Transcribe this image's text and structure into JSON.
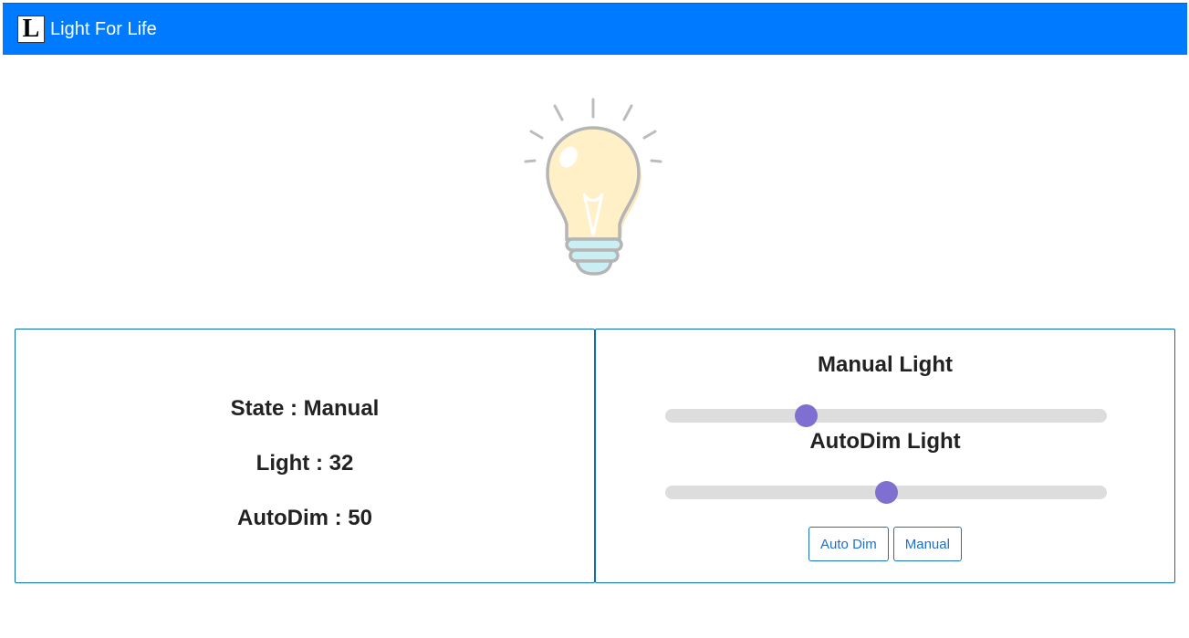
{
  "navbar": {
    "logo_letter": "L",
    "brand": "Light For Life",
    "color": "#007bff"
  },
  "status": {
    "state": "State : Manual",
    "light": "Light : 32",
    "autodim": "AutoDim : 50"
  },
  "controls": {
    "manual_title": "Manual Light",
    "manual_value": 32,
    "autodim_title": "AutoDim Light",
    "autodim_value": 50,
    "slider_max": 100,
    "thumb_color": "#7f6fd0",
    "auto_dim_button": "Auto Dim",
    "manual_button": "Manual"
  },
  "bulb": {
    "icon": "light-bulb-icon"
  }
}
